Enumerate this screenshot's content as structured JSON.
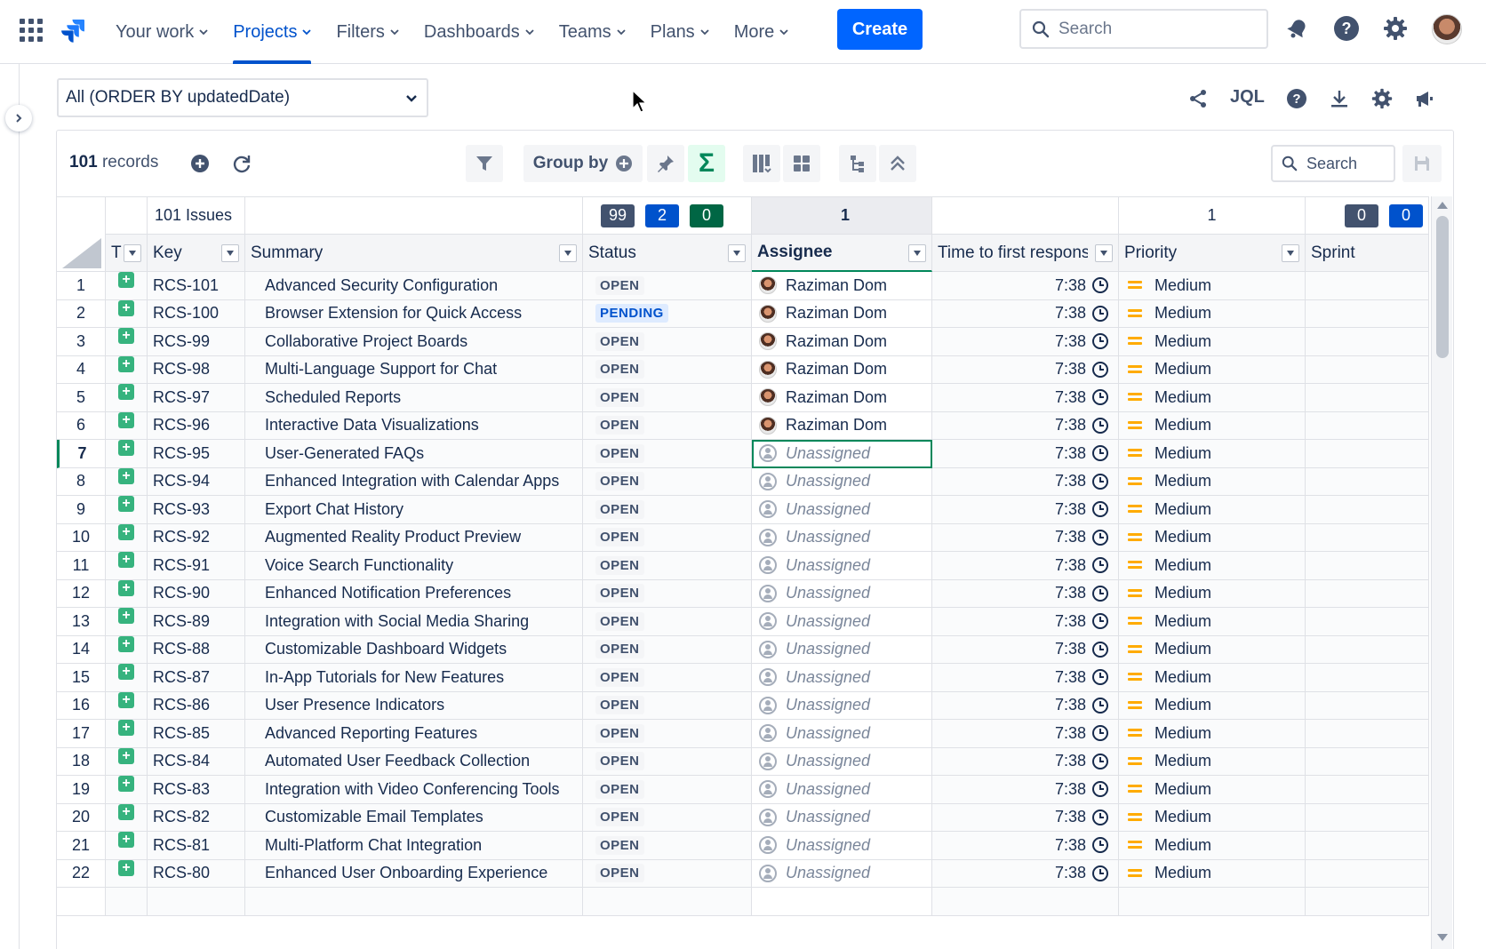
{
  "nav": {
    "items": [
      {
        "label": "Your work",
        "active": false
      },
      {
        "label": "Projects",
        "active": true
      },
      {
        "label": "Filters",
        "active": false
      },
      {
        "label": "Dashboards",
        "active": false
      },
      {
        "label": "Teams",
        "active": false
      },
      {
        "label": "Plans",
        "active": false
      },
      {
        "label": "More",
        "active": false
      }
    ],
    "create_label": "Create",
    "search_placeholder": "Search"
  },
  "filter": {
    "selected": "All (ORDER BY updatedDate)",
    "jql_label": "JQL"
  },
  "toolbar": {
    "records_count": "101",
    "records_label": "records",
    "group_by_label": "Group by",
    "search_placeholder": "Search"
  },
  "grid": {
    "summary_row": {
      "issues_label": "101 Issues",
      "status_counts": [
        {
          "value": "99",
          "color": "#42526e"
        },
        {
          "value": "2",
          "color": "#0052cc"
        },
        {
          "value": "0",
          "color": "#006644"
        }
      ],
      "assignee_count": "1",
      "priority_count": "1",
      "sprint_counts": [
        {
          "value": "0",
          "color": "#42526e"
        },
        {
          "value": "0",
          "color": "#0052cc"
        }
      ]
    },
    "columns": {
      "type": "T",
      "key": "Key",
      "summary": "Summary",
      "status": "Status",
      "assignee": "Assignee",
      "time": "Time to first response",
      "priority": "Priority",
      "sprint": "Sprint"
    },
    "selected_row": 7,
    "rows": [
      {
        "num": "1",
        "key": "RCS-101",
        "summary": "Advanced Security Configuration",
        "status": "OPEN",
        "assignee": "Raziman Dom",
        "time": "7:38",
        "priority": "Medium"
      },
      {
        "num": "2",
        "key": "RCS-100",
        "summary": "Browser Extension for Quick Access",
        "status": "PENDING",
        "assignee": "Raziman Dom",
        "time": "7:38",
        "priority": "Medium"
      },
      {
        "num": "3",
        "key": "RCS-99",
        "summary": "Collaborative Project Boards",
        "status": "OPEN",
        "assignee": "Raziman Dom",
        "time": "7:38",
        "priority": "Medium"
      },
      {
        "num": "4",
        "key": "RCS-98",
        "summary": "Multi-Language Support for Chat",
        "status": "OPEN",
        "assignee": "Raziman Dom",
        "time": "7:38",
        "priority": "Medium"
      },
      {
        "num": "5",
        "key": "RCS-97",
        "summary": "Scheduled Reports",
        "status": "OPEN",
        "assignee": "Raziman Dom",
        "time": "7:38",
        "priority": "Medium"
      },
      {
        "num": "6",
        "key": "RCS-96",
        "summary": "Interactive Data Visualizations",
        "status": "OPEN",
        "assignee": "Raziman Dom",
        "time": "7:38",
        "priority": "Medium"
      },
      {
        "num": "7",
        "key": "RCS-95",
        "summary": "User-Generated FAQs",
        "status": "OPEN",
        "assignee": "Unassigned",
        "time": "7:38",
        "priority": "Medium"
      },
      {
        "num": "8",
        "key": "RCS-94",
        "summary": "Enhanced Integration with Calendar Apps",
        "status": "OPEN",
        "assignee": "Unassigned",
        "time": "7:38",
        "priority": "Medium"
      },
      {
        "num": "9",
        "key": "RCS-93",
        "summary": "Export Chat History",
        "status": "OPEN",
        "assignee": "Unassigned",
        "time": "7:38",
        "priority": "Medium"
      },
      {
        "num": "10",
        "key": "RCS-92",
        "summary": "Augmented Reality Product Preview",
        "status": "OPEN",
        "assignee": "Unassigned",
        "time": "7:38",
        "priority": "Medium"
      },
      {
        "num": "11",
        "key": "RCS-91",
        "summary": "Voice Search Functionality",
        "status": "OPEN",
        "assignee": "Unassigned",
        "time": "7:38",
        "priority": "Medium"
      },
      {
        "num": "12",
        "key": "RCS-90",
        "summary": "Enhanced Notification Preferences",
        "status": "OPEN",
        "assignee": "Unassigned",
        "time": "7:38",
        "priority": "Medium"
      },
      {
        "num": "13",
        "key": "RCS-89",
        "summary": "Integration with Social Media Sharing",
        "status": "OPEN",
        "assignee": "Unassigned",
        "time": "7:38",
        "priority": "Medium"
      },
      {
        "num": "14",
        "key": "RCS-88",
        "summary": "Customizable Dashboard Widgets",
        "status": "OPEN",
        "assignee": "Unassigned",
        "time": "7:38",
        "priority": "Medium"
      },
      {
        "num": "15",
        "key": "RCS-87",
        "summary": "In-App Tutorials for New Features",
        "status": "OPEN",
        "assignee": "Unassigned",
        "time": "7:38",
        "priority": "Medium"
      },
      {
        "num": "16",
        "key": "RCS-86",
        "summary": "User Presence Indicators",
        "status": "OPEN",
        "assignee": "Unassigned",
        "time": "7:38",
        "priority": "Medium"
      },
      {
        "num": "17",
        "key": "RCS-85",
        "summary": "Advanced Reporting Features",
        "status": "OPEN",
        "assignee": "Unassigned",
        "time": "7:38",
        "priority": "Medium"
      },
      {
        "num": "18",
        "key": "RCS-84",
        "summary": "Automated User Feedback Collection",
        "status": "OPEN",
        "assignee": "Unassigned",
        "time": "7:38",
        "priority": "Medium"
      },
      {
        "num": "19",
        "key": "RCS-83",
        "summary": "Integration with Video Conferencing Tools",
        "status": "OPEN",
        "assignee": "Unassigned",
        "time": "7:38",
        "priority": "Medium"
      },
      {
        "num": "20",
        "key": "RCS-82",
        "summary": "Customizable Email Templates",
        "status": "OPEN",
        "assignee": "Unassigned",
        "time": "7:38",
        "priority": "Medium"
      },
      {
        "num": "21",
        "key": "RCS-81",
        "summary": "Multi-Platform Chat Integration",
        "status": "OPEN",
        "assignee": "Unassigned",
        "time": "7:38",
        "priority": "Medium"
      },
      {
        "num": "22",
        "key": "RCS-80",
        "summary": "Enhanced User Onboarding Experience",
        "status": "OPEN",
        "assignee": "Unassigned",
        "time": "7:38",
        "priority": "Medium"
      }
    ]
  }
}
